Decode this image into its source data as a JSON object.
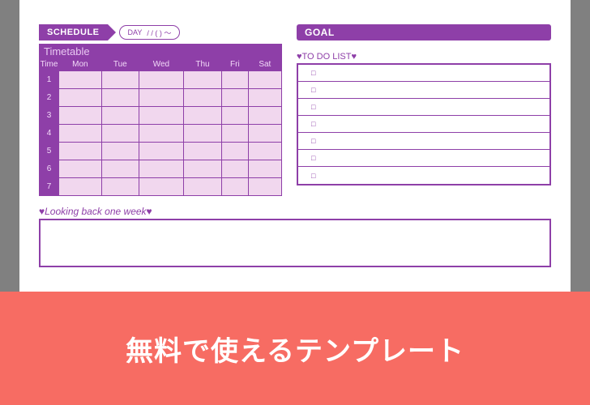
{
  "colors": {
    "accent": "#8e3fa8",
    "cell": "#f1d7ee",
    "banner": "#f76c63"
  },
  "schedule": {
    "tab_label": "SCHEDULE",
    "day_label": "DAY",
    "date_placeholder": "/    /    (  )  〜",
    "timetable_title": "Timetable",
    "headers": [
      "Time",
      "Mon",
      "Tue",
      "Wed",
      "Thu",
      "Fri",
      "Sat"
    ],
    "rows": [
      "1",
      "2",
      "3",
      "4",
      "5",
      "6",
      "7"
    ]
  },
  "goal": {
    "label": "GOAL"
  },
  "todo": {
    "title": "♥TO DO LIST♥",
    "checkbox_glyph": "□",
    "row_count": 7
  },
  "lookback": {
    "title": "♥Looking back one week♥"
  },
  "banner": {
    "text": "無料で使えるテンプレート"
  }
}
